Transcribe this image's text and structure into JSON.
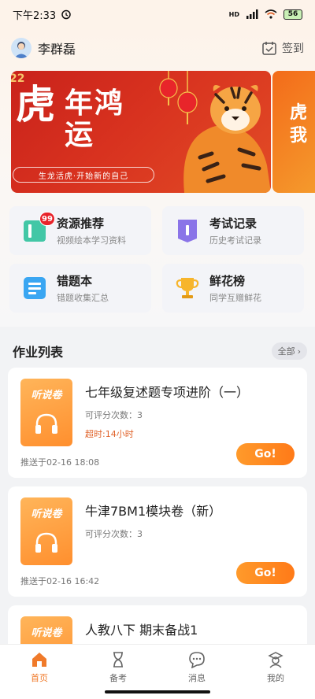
{
  "status": {
    "time": "下午2:33",
    "net": "HD",
    "battery": "56"
  },
  "header": {
    "username": "李群磊",
    "signin_label": "签到"
  },
  "banner": {
    "year": "22",
    "title_char": "虎",
    "title_rest": "年鸿运",
    "subtitle": "生龙活虎·开始新的自己",
    "peek_text": "虎\n我"
  },
  "quick": [
    {
      "title": "资源推荐",
      "sub": "视频绘本学习资料",
      "badge": "99",
      "icon": "resource-icon"
    },
    {
      "title": "考试记录",
      "sub": "历史考试记录",
      "icon": "exam-record-icon"
    },
    {
      "title": "错题本",
      "sub": "错题收集汇总",
      "icon": "mistake-book-icon"
    },
    {
      "title": "鲜花榜",
      "sub": "同学互赠鲜花",
      "icon": "trophy-icon"
    }
  ],
  "homework": {
    "title": "作业列表",
    "all_label": "全部",
    "items": [
      {
        "thumb": "听说卷",
        "title": "七年级复述题专项进阶（一）",
        "count": "可评分次数：3",
        "overtime": "超时:14小时",
        "time": "推送于02-16 18:08",
        "go": "Go!"
      },
      {
        "thumb": "听说卷",
        "title": "牛津7BM1模块卷（新）",
        "count": "可评分次数：3",
        "overtime": "",
        "time": "推送于02-16 16:42",
        "go": "Go!"
      },
      {
        "thumb": "听说卷",
        "title": "人教八下 期末备战1",
        "count": "",
        "overtime": "",
        "time": "",
        "go": ""
      }
    ]
  },
  "tabs": [
    {
      "label": "首页",
      "icon": "home-icon",
      "active": true
    },
    {
      "label": "备考",
      "icon": "hourglass-icon",
      "active": false
    },
    {
      "label": "消息",
      "icon": "message-icon",
      "active": false
    },
    {
      "label": "我的",
      "icon": "profile-icon",
      "active": false
    }
  ],
  "colors": {
    "accent": "#f07a2a",
    "banner_red": "#d8321f",
    "overtime": "#e0632a"
  }
}
